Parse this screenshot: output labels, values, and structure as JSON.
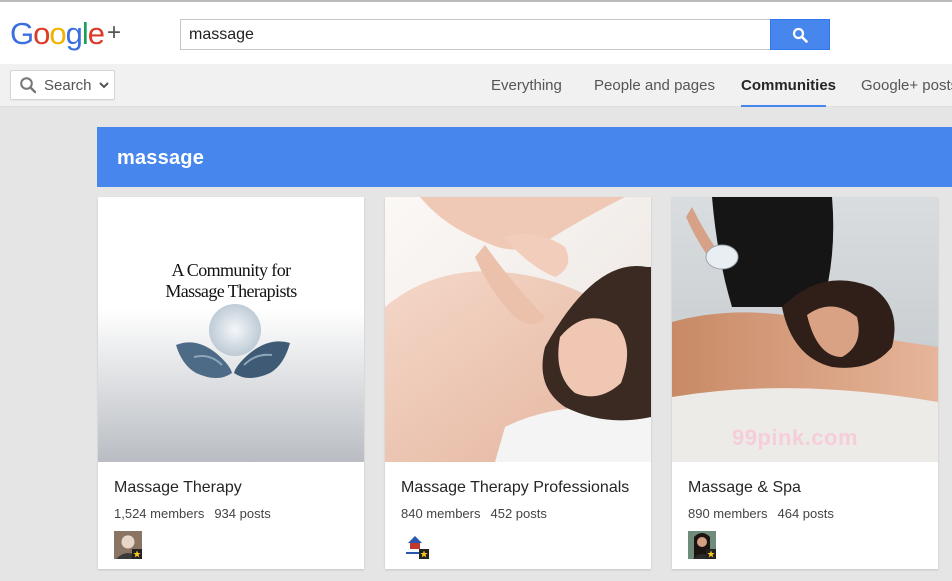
{
  "header": {
    "logo_text": "Google",
    "logo_plus": "+",
    "search_value": "massage"
  },
  "nav": {
    "search_dropdown_label": "Search",
    "tabs": [
      {
        "label": "Everything",
        "active": false
      },
      {
        "label": "People and pages",
        "active": false
      },
      {
        "label": "Communities",
        "active": true
      },
      {
        "label": "Google+ posts",
        "active": false
      }
    ]
  },
  "banner": {
    "title": "massage"
  },
  "cards": [
    {
      "name": "Massage Therapy",
      "members": "1,524 members",
      "posts": "934 posts",
      "image_text_line1": "A Community for",
      "image_text_line2": "Massage Therapists"
    },
    {
      "name": "Massage Therapy Professionals",
      "members": "840 members",
      "posts": "452 posts"
    },
    {
      "name": "Massage & Spa",
      "members": "890 members",
      "posts": "464 posts",
      "image_watermark": "99pink.com"
    }
  ],
  "colors": {
    "accent": "#4787ed",
    "background": "#e5e5e5",
    "navbar": "#f1f1f1"
  }
}
